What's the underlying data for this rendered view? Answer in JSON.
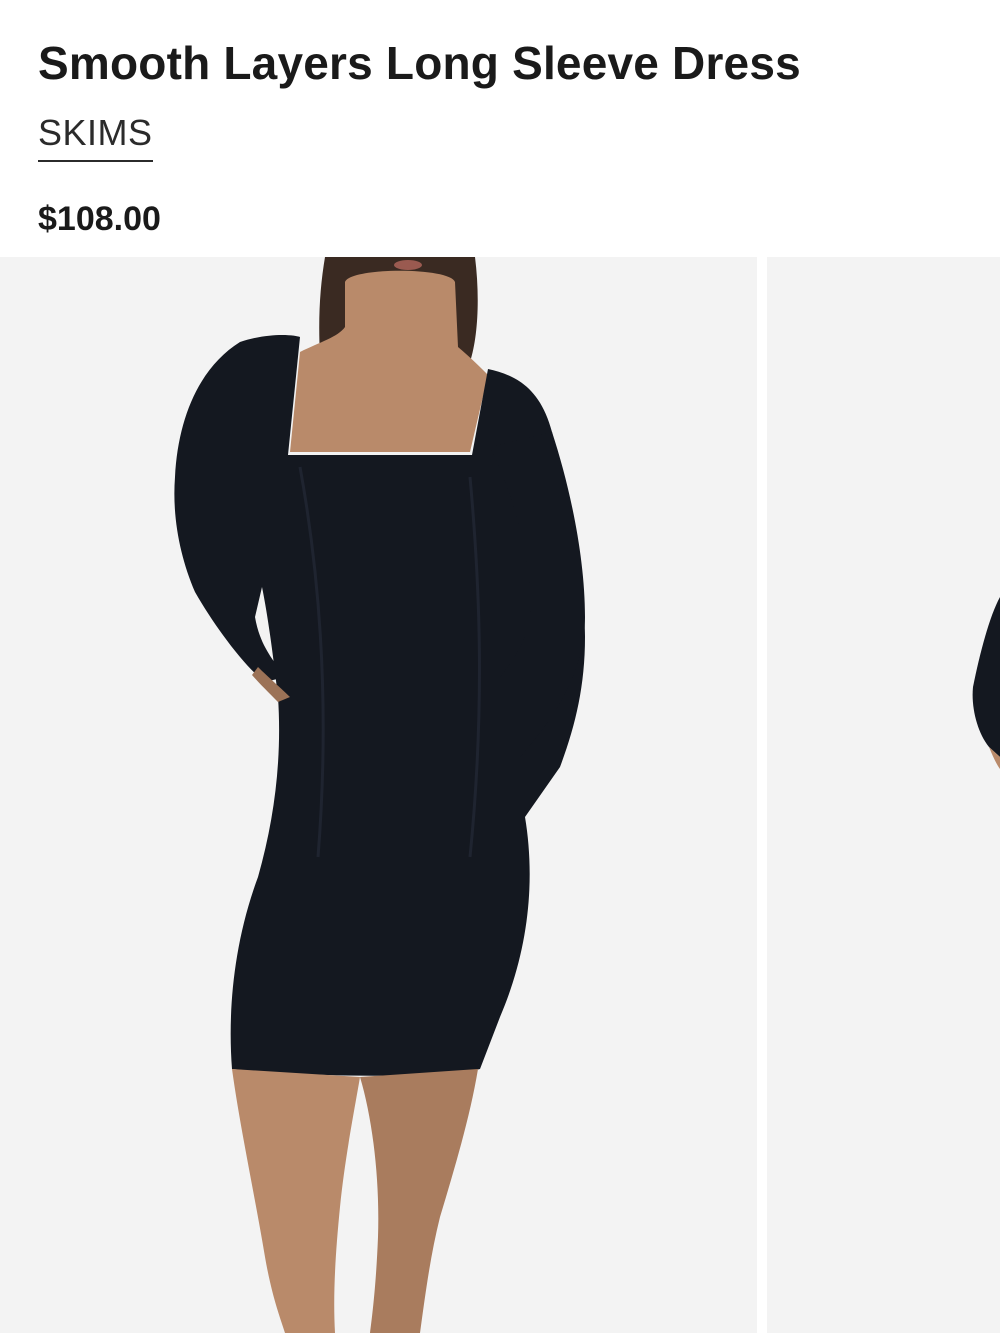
{
  "product": {
    "title": "Smooth Layers Long Sleeve Dress",
    "brand": "SKIMS",
    "price": "$108.00"
  },
  "gallery": {
    "slides": [
      {
        "subject": "model wearing black long sleeve square neck midi dress, front view"
      },
      {
        "subject": "model wearing black dress, partially visible next image"
      }
    ]
  },
  "colors": {
    "background": "#ffffff",
    "image_background": "#f2f2f2",
    "dress": "#141820",
    "skin": "#b98a6a",
    "text": "#1a1a1a"
  }
}
